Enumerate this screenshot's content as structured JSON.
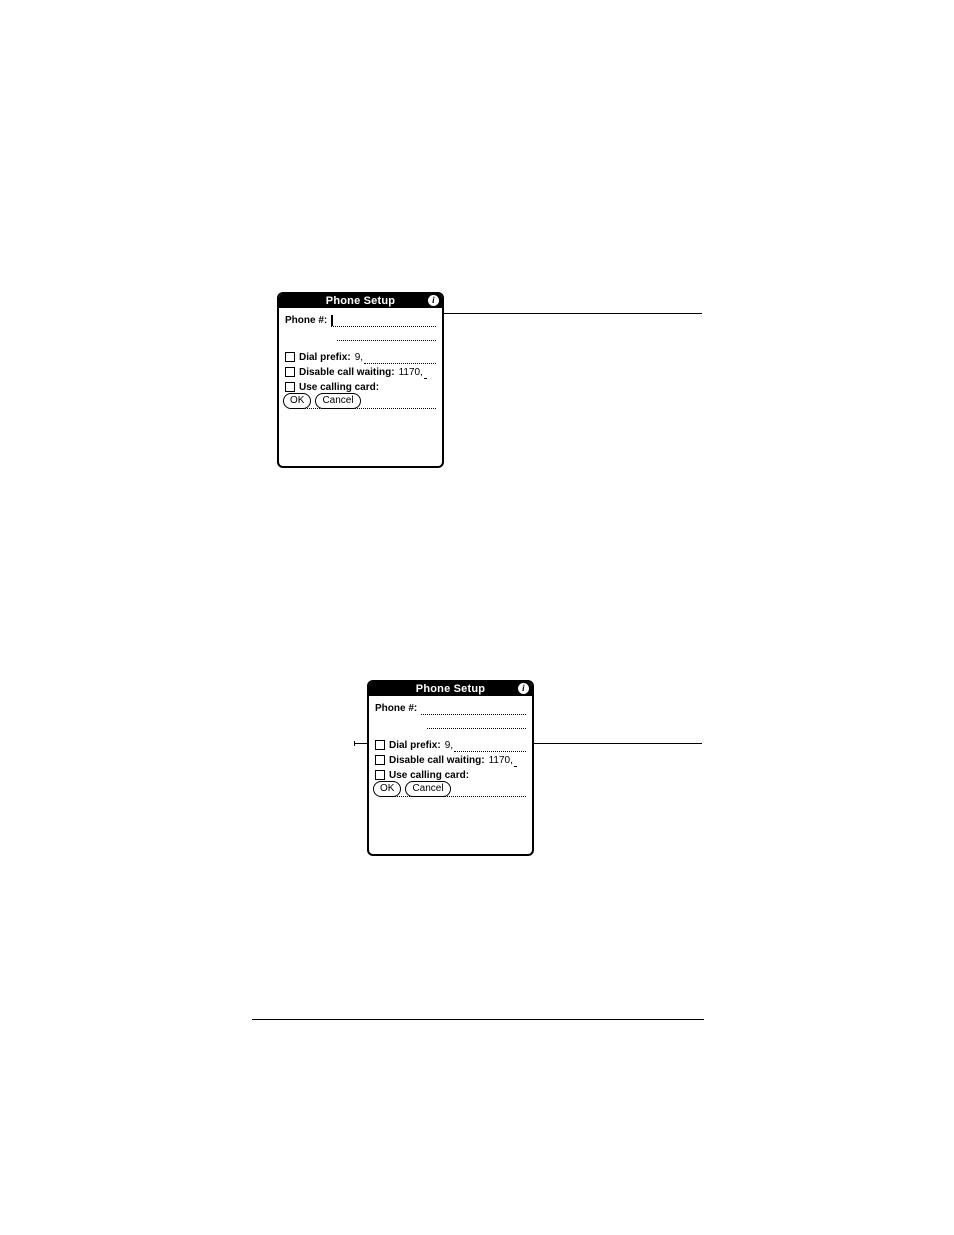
{
  "dialog1": {
    "title": "Phone Setup",
    "info_glyph": "i",
    "phone_label": "Phone #:",
    "phone_value": "",
    "show_cursor": true,
    "dial_prefix_label": "Dial prefix:",
    "dial_prefix_value": "9,",
    "disable_cw_label": "Disable call waiting:",
    "disable_cw_value": "1170,",
    "use_cc_label": "Use calling card:",
    "cc_value": "",
    "ok_label": "OK",
    "cancel_label": "Cancel"
  },
  "dialog2": {
    "title": "Phone Setup",
    "info_glyph": "i",
    "phone_label": "Phone #:",
    "phone_value": "",
    "show_cursor": false,
    "dial_prefix_label": "Dial prefix:",
    "dial_prefix_value": "9,",
    "disable_cw_label": "Disable call waiting:",
    "disable_cw_value": "1170,",
    "use_cc_label": "Use calling card:",
    "cc_value": "",
    "ok_label": "OK",
    "cancel_label": "Cancel"
  }
}
